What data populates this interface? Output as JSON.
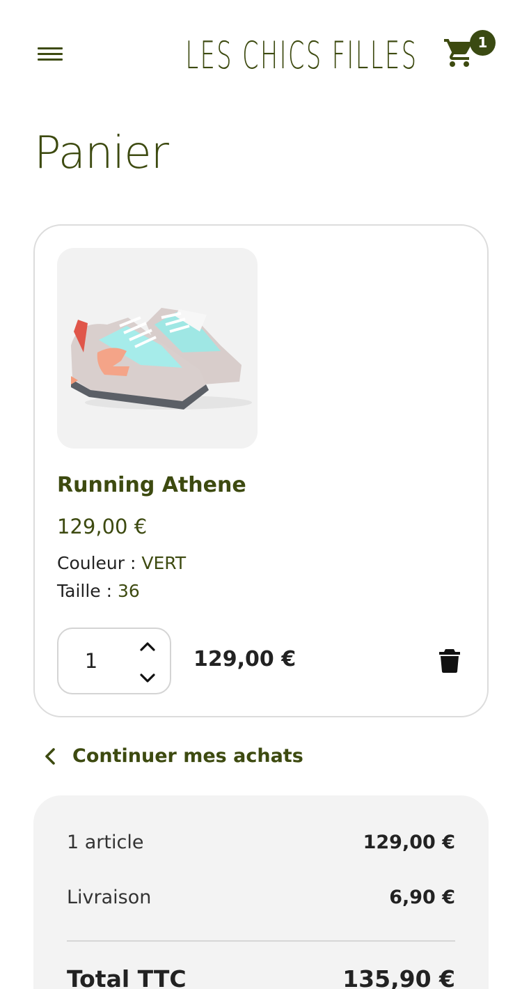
{
  "header": {
    "logo": "LES CHICS FILLES",
    "cart_count": "1"
  },
  "page": {
    "title": "Panier"
  },
  "cart_item": {
    "name": "Running Athene",
    "price": "129,00 €",
    "color_label": "Couleur :",
    "color_value": "VERT",
    "size_label": "Taille :",
    "size_value": "36",
    "quantity": "1",
    "line_total": "129,00 €"
  },
  "continue": {
    "label": "Continuer mes achats"
  },
  "summary": {
    "items_label": "1 article",
    "items_amount": "129,00 €",
    "shipping_label": "Livraison",
    "shipping_amount": "6,90 €",
    "total_label": "Total TTC",
    "total_amount": "135,90 €"
  },
  "colors": {
    "brand": "#3d4a10",
    "badge": "#3a4a12",
    "summary_bg": "#f3f3f3"
  },
  "icons": {
    "menu": "hamburger-icon",
    "cart": "shopping-cart-icon",
    "qty_up": "chevron-up-icon",
    "qty_down": "chevron-down-icon",
    "delete": "trash-icon",
    "back": "chevron-left-icon"
  }
}
